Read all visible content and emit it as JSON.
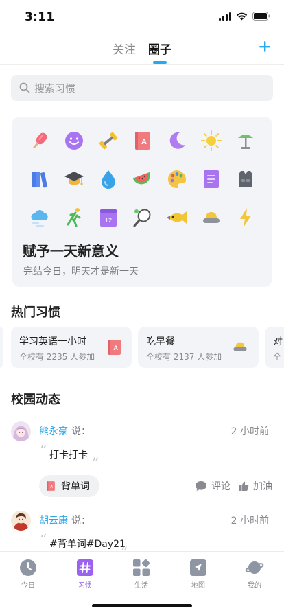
{
  "status_bar": {
    "time": "3:11"
  },
  "nav": {
    "tabs": [
      {
        "label": "关注",
        "active": false
      },
      {
        "label": "圈子",
        "active": true
      }
    ],
    "add_icon": "plus-icon",
    "accent_color": "#27a9ef"
  },
  "search": {
    "placeholder": "搜索习惯",
    "icon": "search-icon"
  },
  "banner": {
    "icons": [
      "popsicle-icon",
      "smiley-face-icon",
      "dumbbell-icon",
      "word-book-icon",
      "moon-icon",
      "sun-icon",
      "desk-lamp-icon",
      "books-icon",
      "graduation-cap-icon",
      "water-drop-icon",
      "watermelon-icon",
      "palette-icon",
      "notebook-icon",
      "vest-icon",
      "cloud-icon",
      "running-person-icon",
      "calendar-12-icon",
      "racket-icon",
      "fish-icon",
      "pudding-icon",
      "lightning-icon"
    ],
    "calendar_day": "12",
    "title": "赋予一天新意义",
    "subtitle": "完结今日，明天才是新一天"
  },
  "hot_habits": {
    "title": "热门习惯",
    "items": [
      {
        "name": "学习英语一小时",
        "count": "全校有 2235 人参加",
        "icon": "word-book-icon"
      },
      {
        "name": "吃早餐",
        "count": "全校有 2137 人参加",
        "icon": "pudding-icon"
      },
      {
        "name": "对",
        "count": "全",
        "icon": ""
      }
    ]
  },
  "campus": {
    "title": "校园动态",
    "posts": [
      {
        "user": "熊永豪",
        "says": "说：",
        "time": "2 小时前",
        "text": "打卡打卡",
        "tag": "背单词",
        "comment": "评论",
        "cheer": "加油"
      },
      {
        "user": "胡云康",
        "says": "说：",
        "time": "2 小时前",
        "text": "#背单词#Day21"
      }
    ]
  },
  "tabbar": {
    "items": [
      {
        "label": "今日",
        "icon": "clock-icon",
        "active": false
      },
      {
        "label": "习惯",
        "icon": "hashtag-icon",
        "active": true
      },
      {
        "label": "生活",
        "icon": "grid-icon",
        "active": false
      },
      {
        "label": "地图",
        "icon": "map-icon",
        "active": false
      },
      {
        "label": "我的",
        "icon": "planet-icon",
        "active": false
      }
    ],
    "active_color": "#8e59e6"
  },
  "word_book_letter": "A"
}
